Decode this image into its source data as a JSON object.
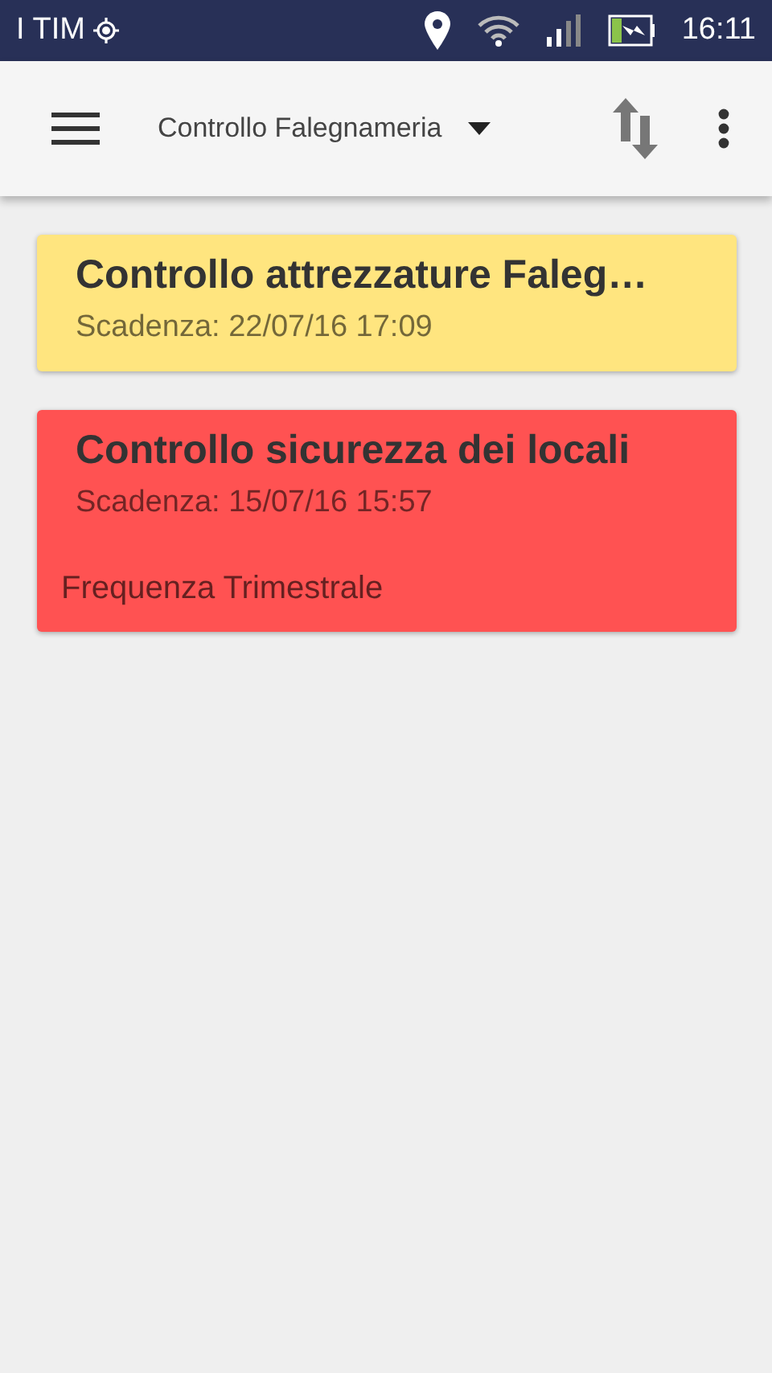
{
  "status_bar": {
    "carrier": "I TIM",
    "time": "16:11"
  },
  "toolbar": {
    "title": "Controllo Falegnameria"
  },
  "tasks": [
    {
      "title": "Controllo attrezzature Faleg…",
      "due": "Scadenza: 22/07/16 17:09",
      "color": "#ffe57f"
    },
    {
      "title": "Controllo sicurezza dei locali",
      "due": "Scadenza: 15/07/16 15:57",
      "frequency": "Frequenza Trimestrale",
      "color": "#ff5252"
    }
  ]
}
